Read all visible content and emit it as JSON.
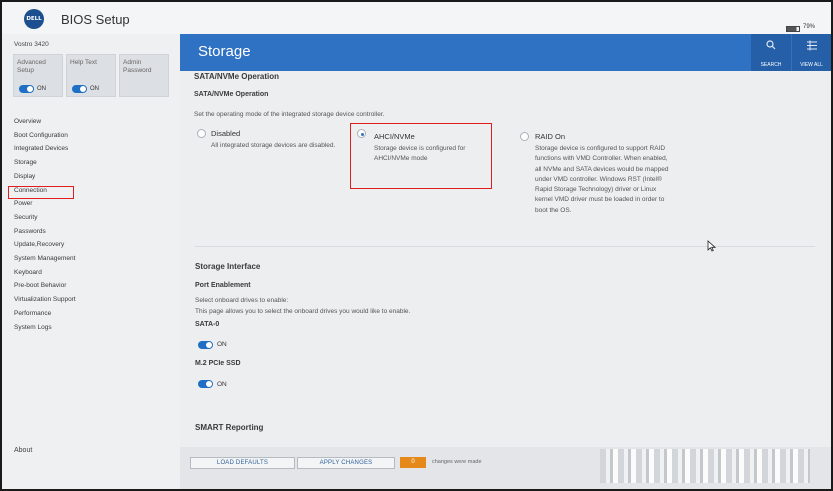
{
  "app": {
    "logo_text": "DELL",
    "title": "BIOS Setup",
    "battery": "79%"
  },
  "sidebar": {
    "model": "Vostro 3420",
    "tiles": [
      {
        "label": "Advanced Setup",
        "state": "ON"
      },
      {
        "label": "Help Text",
        "state": "ON"
      },
      {
        "label": "Admin Password",
        "state": ""
      }
    ],
    "items": [
      "Overview",
      "Boot Configuration",
      "Integrated Devices",
      "Storage",
      "Display",
      "Connection",
      "Power",
      "Security",
      "Passwords",
      "Update,Recovery",
      "System Management",
      "Keyboard",
      "Pre-boot Behavior",
      "Virtualization Support",
      "Performance",
      "System Logs"
    ],
    "selected": "Storage",
    "about": "About"
  },
  "header": {
    "title": "Storage",
    "search_label": "SEARCH",
    "viewall_label": "VIEW ALL"
  },
  "content": {
    "section_title": "SATA/NVMe Operation",
    "subsection": "SATA/NVMe Operation",
    "description": "Set the operating mode of the integrated storage device controller.",
    "options": [
      {
        "title": "Disabled",
        "desc": "All integrated storage devices are disabled.",
        "selected": false
      },
      {
        "title": "AHCI/NVMe",
        "desc": "Storage device is configured for AHCI/NVMe mode",
        "selected": true
      },
      {
        "title": "RAID On",
        "desc": "Storage device is configured to support RAID functions with VMD Controller. When enabled, all NVMe and SATA devices would be mapped under VMD controller. Windows RST (Intel® Rapid Storage Technology) driver or Linux kernel VMD driver must be loaded in order to boot the OS.",
        "selected": false
      }
    ],
    "storage_interface": "Storage Interface",
    "port_enablement": "Port Enablement",
    "port_desc1": "Select onboard drives to enable:",
    "port_desc2": "This page allows you to select the onboard drives you would like to enable.",
    "drives": [
      {
        "name": "SATA-0",
        "state": "ON"
      },
      {
        "name": "M.2 PCIe SSD",
        "state": "ON"
      }
    ],
    "smart_reporting": "SMART Reporting"
  },
  "footer": {
    "load_defaults": "LOAD DEFAULTS",
    "apply_changes": "APPLY CHANGES",
    "change_count": "0",
    "change_text": "changes were made"
  }
}
